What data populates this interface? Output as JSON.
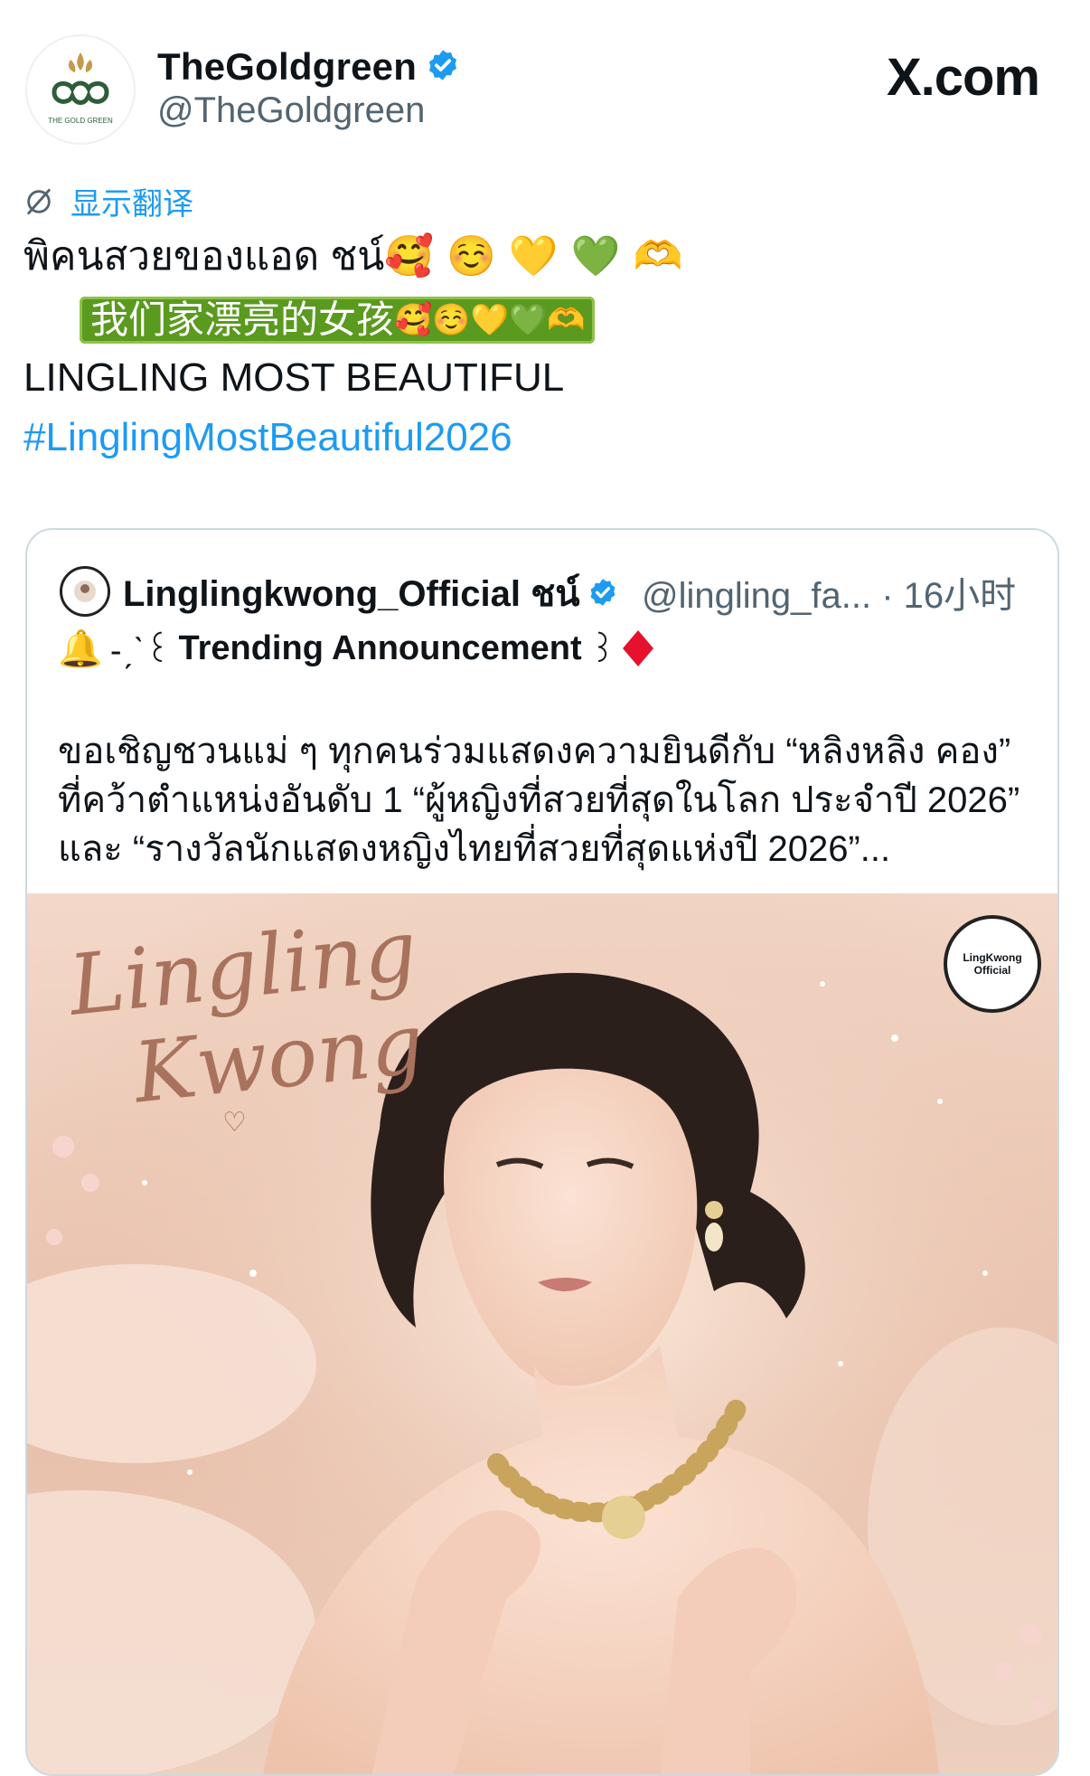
{
  "author": {
    "display_name": "TheGoldgreen",
    "handle": "@TheGoldgreen",
    "avatar_text": "THE GOLD GREEN",
    "verified": true
  },
  "watermark": "X.com",
  "translate": {
    "label": "显示翻译"
  },
  "post": {
    "thai_text": "พิคนสวยของแอด ชน์",
    "thai_emojis": "🥰 ☺️ 💛 💚 🫶",
    "zh_text": "我们家漂亮的女孩",
    "zh_emojis": "🥰☺️💛💚🫶",
    "caps_text": "LINGLING MOST BEAUTIFUL",
    "hashtag": "#LinglingMostBeautiful2026"
  },
  "quote": {
    "name": "Linglingkwong_Official ชน์",
    "handle": "@lingling_fa...",
    "time": "· 16小时",
    "announce_prefix": "-ˏˋ꒰",
    "announce_title": "Trending Announcement",
    "announce_suffix": "꒱",
    "body": "ขอเชิญชวนแม่ ๆ ทุกคนร่วมแสดงความยินดีกับ “หลิงหลิง คอง” ที่คว้าตำแหน่งอันดับ 1 “ผู้หญิงที่สวยที่สุดในโลก ประจำปี 2026” และ “รางวัลนักแสดงหญิงไทยที่สวยที่สุดแห่งปี 2026”...",
    "image": {
      "script_line1": "Lingling",
      "script_line2": "Kwong",
      "badge_text": "LingKwong Official"
    }
  },
  "colors": {
    "link": "#1d9bf0",
    "secondary": "#536471",
    "badge_green": "#5a9a1e",
    "verified_blue": "#1d9bf0"
  },
  "icons": [
    "verified-badge-icon",
    "translate-icon",
    "bell-icon",
    "red-diamond-icon"
  ]
}
